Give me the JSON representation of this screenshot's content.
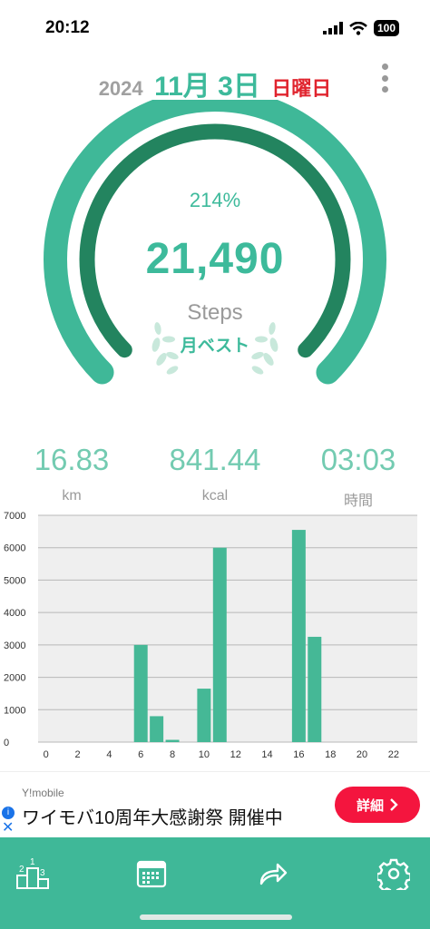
{
  "status_bar": {
    "time": "20:12",
    "battery": "100"
  },
  "header": {
    "year": "2024",
    "month_day": "11月 3日",
    "weekday": "日曜日"
  },
  "summary": {
    "percent": "214%",
    "steps": "21,490",
    "steps_label": "Steps",
    "best_label": "月ベスト",
    "progress_fraction": 1.0,
    "goal_fraction": 1.0
  },
  "stats": [
    {
      "value": "16.83",
      "unit": "km"
    },
    {
      "value": "841.44",
      "unit": "kcal"
    },
    {
      "value": "03:03",
      "unit": "時間"
    }
  ],
  "chart_data": {
    "type": "bar",
    "x_ticks": [
      "0",
      "2",
      "4",
      "6",
      "8",
      "10",
      "12",
      "14",
      "16",
      "18",
      "20",
      "22"
    ],
    "y_ticks": [
      "0",
      "1000",
      "2000",
      "3000",
      "4000",
      "5000",
      "6000",
      "7000"
    ],
    "ylim": [
      0,
      7000
    ],
    "xlim": [
      -0.5,
      23.5
    ],
    "hours": [
      6,
      7,
      8,
      10,
      11,
      16,
      17
    ],
    "values": [
      3000,
      800,
      70,
      1650,
      6000,
      6550,
      3250
    ],
    "bar_color": "#45b896",
    "background": "#efefef",
    "grid": true
  },
  "ad": {
    "brand": "Y!mobile",
    "text": "ワイモバ10周年大感謝祭 開催中",
    "button_label": "詳細",
    "info_glyph": "i",
    "close_glyph": "✕"
  },
  "nav": {
    "ranking_icon": "ranking-podium-icon",
    "calendar_icon": "calendar-icon",
    "share_icon": "share-arrow-icon",
    "settings_icon": "gear-icon"
  },
  "colors": {
    "accent": "#3dba9b",
    "dark_accent": "#23845f",
    "weekday": "#e0242e",
    "ad_button": "#f4153e",
    "nav_bg": "#3fb898"
  }
}
